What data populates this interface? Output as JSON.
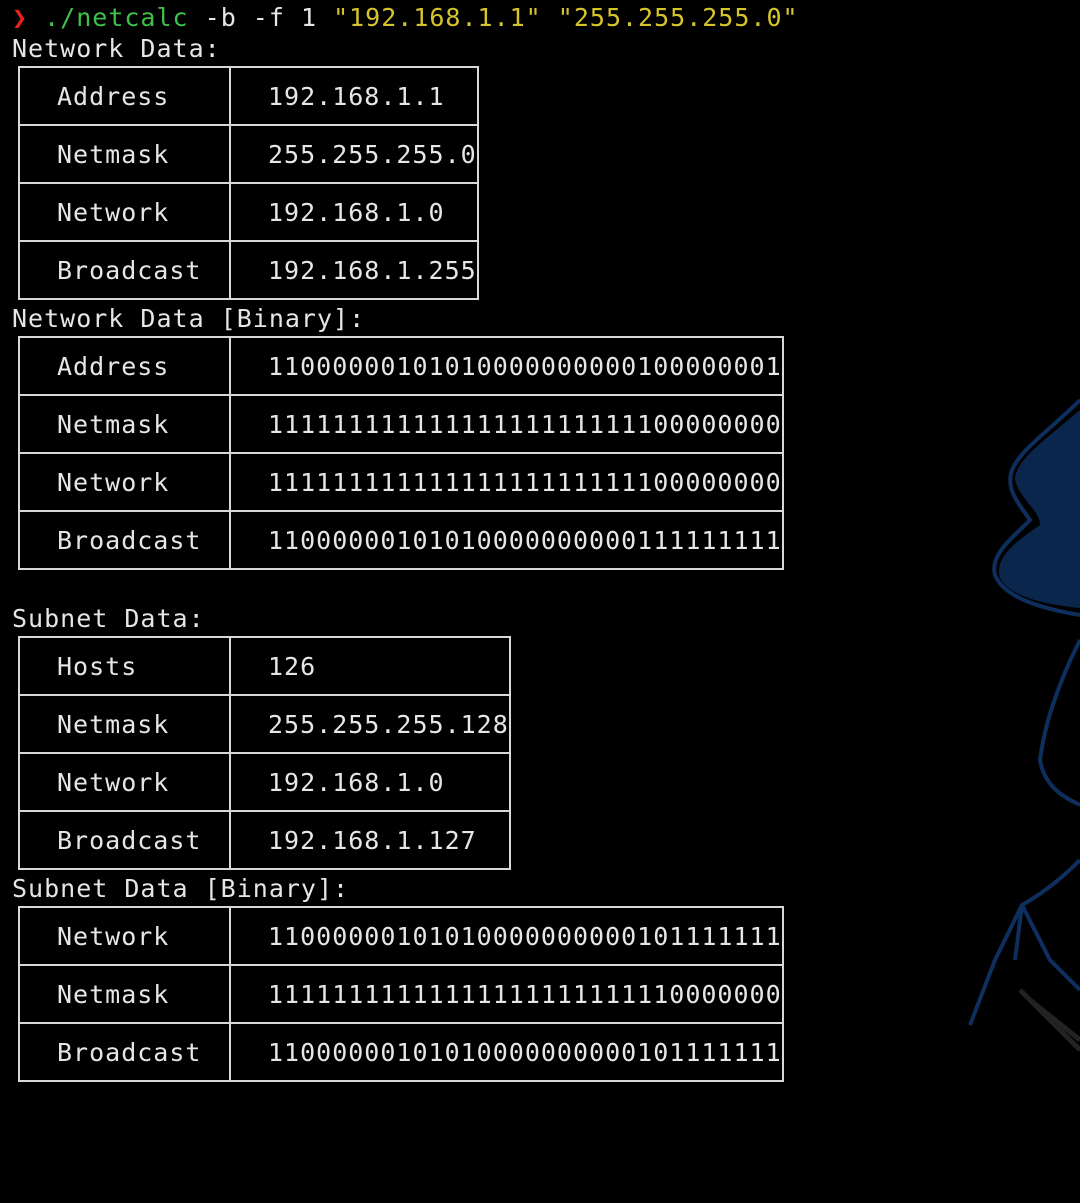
{
  "prompt": {
    "arrow": "❯",
    "command": "./netcalc",
    "flags": " -b -f 1 ",
    "arg1": "\"192.168.1.1\"",
    "space": " ",
    "arg2": "\"255.255.255.0\""
  },
  "colors": {
    "background": "#000000",
    "text": "#e6e6e6",
    "prompt_arrow": "#e5231b",
    "command": "#3fc04b",
    "string": "#d6c42b",
    "wallpaper_accent": "#0b2a55"
  },
  "sections": [
    {
      "heading": "Network Data:",
      "rows": [
        {
          "key": "Address",
          "value": "192.168.1.1"
        },
        {
          "key": "Netmask",
          "value": "255.255.255.0"
        },
        {
          "key": "Network",
          "value": "192.168.1.0"
        },
        {
          "key": "Broadcast",
          "value": "192.168.1.255"
        }
      ]
    },
    {
      "heading": "Network Data [Binary]:",
      "rows": [
        {
          "key": "Address",
          "value": "11000000101010000000000100000001"
        },
        {
          "key": "Netmask",
          "value": "11111111111111111111111100000000"
        },
        {
          "key": "Network",
          "value": "11111111111111111111111100000000"
        },
        {
          "key": "Broadcast",
          "value": "11000000101010000000000111111111"
        }
      ]
    },
    {
      "heading": "Subnet Data:",
      "rows": [
        {
          "key": "Hosts",
          "value": "126"
        },
        {
          "key": "Netmask",
          "value": "255.255.255.128"
        },
        {
          "key": "Network",
          "value": "192.168.1.0"
        },
        {
          "key": "Broadcast",
          "value": "192.168.1.127"
        }
      ]
    },
    {
      "heading": "Subnet Data [Binary]:",
      "rows": [
        {
          "key": "Network",
          "value": "11000000101010000000000101111111"
        },
        {
          "key": "Netmask",
          "value": "11111111111111111111111110000000"
        },
        {
          "key": "Broadcast",
          "value": "11000000101010000000000101111111"
        }
      ]
    }
  ]
}
